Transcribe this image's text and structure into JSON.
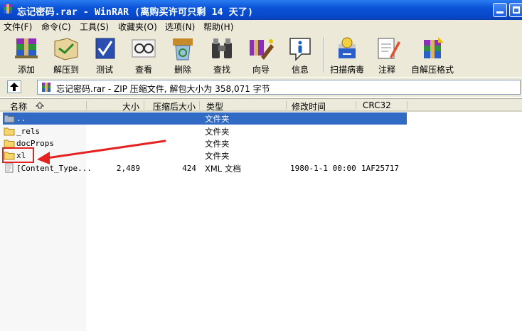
{
  "window": {
    "title": "忘记密码.rar - WinRAR (离购买许可只剩 14 天了)"
  },
  "menu": {
    "items": [
      "文件(F)",
      "命令(C)",
      "工具(S)",
      "收藏夹(O)",
      "选项(N)",
      "帮助(H)"
    ]
  },
  "toolbar": {
    "buttons": [
      "添加",
      "解压到",
      "测试",
      "查看",
      "删除",
      "查找",
      "向导",
      "信息",
      "扫描病毒",
      "注释",
      "自解压格式"
    ]
  },
  "address": {
    "text": "忘记密码.rar - ZIP 压缩文件, 解包大小为 358,071 字节"
  },
  "list": {
    "columns": [
      "名称",
      "大小",
      "压缩后大小",
      "类型",
      "修改时间",
      "CRC32"
    ],
    "rows": [
      {
        "name": "..",
        "size": "",
        "packed": "",
        "type": "文件夹",
        "modified": "",
        "crc": ""
      },
      {
        "name": "_rels",
        "size": "",
        "packed": "",
        "type": "文件夹",
        "modified": "",
        "crc": ""
      },
      {
        "name": "docProps",
        "size": "",
        "packed": "",
        "type": "文件夹",
        "modified": "",
        "crc": ""
      },
      {
        "name": "xl",
        "size": "",
        "packed": "",
        "type": "文件夹",
        "modified": "",
        "crc": ""
      },
      {
        "name": "[Content_Type...",
        "size": "2,489",
        "packed": "424",
        "type": "XML 文档",
        "modified": "1980-1-1 00:00",
        "crc": "1AF25717"
      }
    ]
  },
  "colors": {
    "titlebar": "#0a52d8",
    "selection": "#316ac5",
    "annotation": "#e52222"
  }
}
